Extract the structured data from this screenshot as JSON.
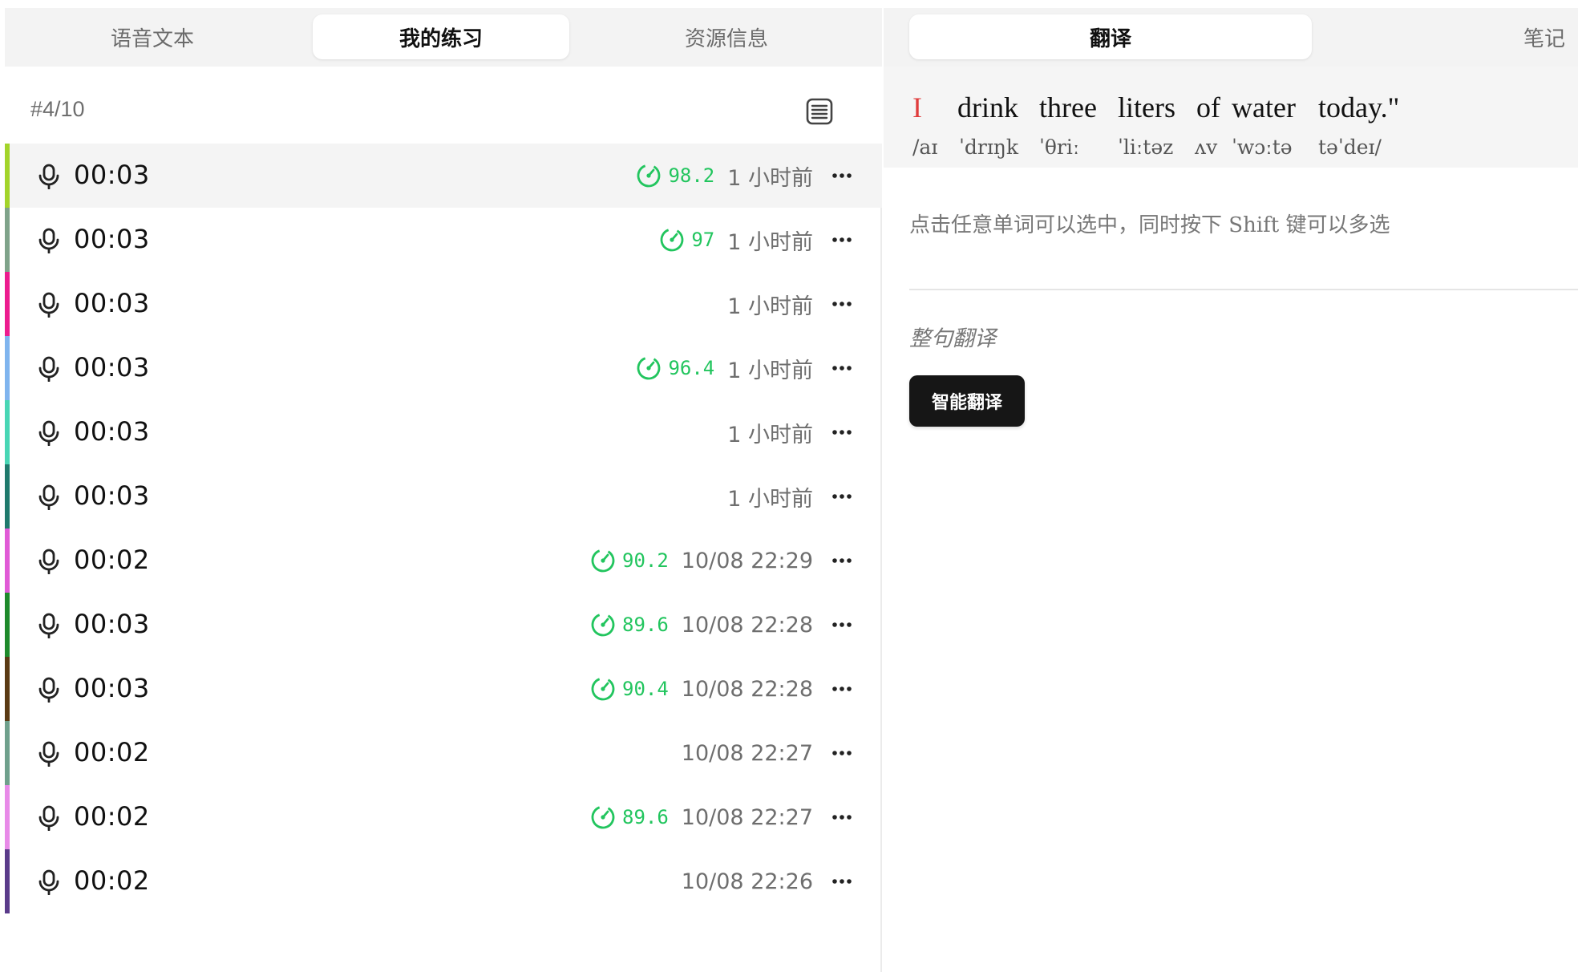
{
  "left_tabs": [
    {
      "label": "语音文本",
      "active": false
    },
    {
      "label": "我的练习",
      "active": true
    },
    {
      "label": "资源信息",
      "active": false
    }
  ],
  "counter": "#4/10",
  "recordings": [
    {
      "duration": "00:03",
      "score": "98.2",
      "time": "1 小时前",
      "color": "#a3d42a"
    },
    {
      "duration": "00:03",
      "score": "97",
      "time": "1 小时前",
      "color": "#7fa38a"
    },
    {
      "duration": "00:03",
      "score": "",
      "time": "1 小时前",
      "color": "#ec1c8e"
    },
    {
      "duration": "00:03",
      "score": "96.4",
      "time": "1 小时前",
      "color": "#7fb4ee"
    },
    {
      "duration": "00:03",
      "score": "",
      "time": "1 小时前",
      "color": "#48d6b4"
    },
    {
      "duration": "00:03",
      "score": "",
      "time": "1 小时前",
      "color": "#1f7a6c"
    },
    {
      "duration": "00:02",
      "score": "90.2",
      "time": "10/08 22:29",
      "color": "#e05ad6"
    },
    {
      "duration": "00:03",
      "score": "89.6",
      "time": "10/08 22:28",
      "color": "#1e8a2b"
    },
    {
      "duration": "00:03",
      "score": "90.4",
      "time": "10/08 22:28",
      "color": "#5a3a14"
    },
    {
      "duration": "00:02",
      "score": "",
      "time": "10/08 22:27",
      "color": "#6fa08c"
    },
    {
      "duration": "00:02",
      "score": "89.6",
      "time": "10/08 22:27",
      "color": "#e88ae8"
    },
    {
      "duration": "00:02",
      "score": "",
      "time": "10/08 22:26",
      "color": "#5a3b8a"
    }
  ],
  "right_tabs": [
    {
      "label": "翻译",
      "active": true
    },
    {
      "label": "笔记",
      "active": false
    }
  ],
  "sentence": {
    "words": [
      "I",
      "drink",
      "three",
      "liters",
      "of",
      "water",
      "today.\""
    ],
    "highlight_index": 0,
    "ipa": [
      "/aɪ",
      "ˈdrɪŋk",
      "ˈθriː",
      "ˈliːtəz",
      "ʌv",
      "ˈwɔːtə",
      "təˈdeɪ/"
    ]
  },
  "hint": "点击任意单词可以选中，同时按下 Shift 键可以多选",
  "section_label": "整句翻译",
  "translate_button": "智能翻译",
  "colors": {
    "accent_green": "#22c55e",
    "highlight_red": "#e03c3c",
    "button_dark": "#161616"
  },
  "icons": {
    "mic": "microphone-icon",
    "score": "gauge-check-icon",
    "more": "more-dots-icon",
    "list": "list-document-icon"
  }
}
